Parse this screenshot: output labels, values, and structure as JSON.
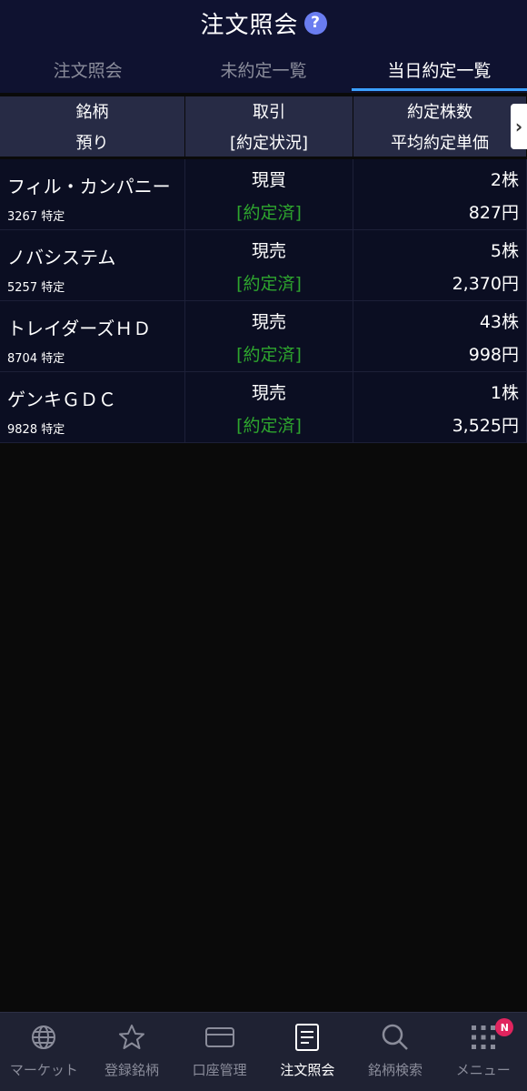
{
  "header": {
    "title": "注文照会",
    "help_glyph": "?"
  },
  "tabs": [
    {
      "label": "注文照会",
      "active": false
    },
    {
      "label": "未約定一覧",
      "active": false
    },
    {
      "label": "当日約定一覧",
      "active": true
    }
  ],
  "columns": {
    "c1_top": "銘柄",
    "c1_bottom": "預り",
    "c2_top": "取引",
    "c2_bottom": "[約定状況]",
    "c3_top": "約定株数",
    "c3_bottom": "平均約定単価",
    "scroll_glyph": "›"
  },
  "rows": [
    {
      "name": "フィル・カンパニー",
      "code_account": "3267 特定",
      "trade": "現買",
      "status": "[約定済]",
      "qty": "2株",
      "price": "827円"
    },
    {
      "name": "ノバシステム",
      "code_account": "5257 特定",
      "trade": "現売",
      "status": "[約定済]",
      "qty": "5株",
      "price": "2,370円"
    },
    {
      "name": "トレイダーズＨＤ",
      "code_account": "8704 特定",
      "trade": "現売",
      "status": "[約定済]",
      "qty": "43株",
      "price": "998円"
    },
    {
      "name": "ゲンキＧＤＣ",
      "code_account": "9828 特定",
      "trade": "現売",
      "status": "[約定済]",
      "qty": "1株",
      "price": "3,525円"
    }
  ],
  "bottom_nav": {
    "items": [
      {
        "label": "マーケット",
        "icon": "globe-icon"
      },
      {
        "label": "登録銘柄",
        "icon": "star-icon"
      },
      {
        "label": "口座管理",
        "icon": "card-icon"
      },
      {
        "label": "注文照会",
        "icon": "document-icon",
        "active": true
      },
      {
        "label": "銘柄検索",
        "icon": "search-icon"
      },
      {
        "label": "メニュー",
        "icon": "grid-icon",
        "badge": "N"
      }
    ]
  },
  "colors": {
    "header_bg": "#0f1230",
    "accent": "#3ba0ff",
    "status_green": "#2ea52e",
    "badge_red": "#e0245e",
    "help_blue": "#6a7df0"
  }
}
